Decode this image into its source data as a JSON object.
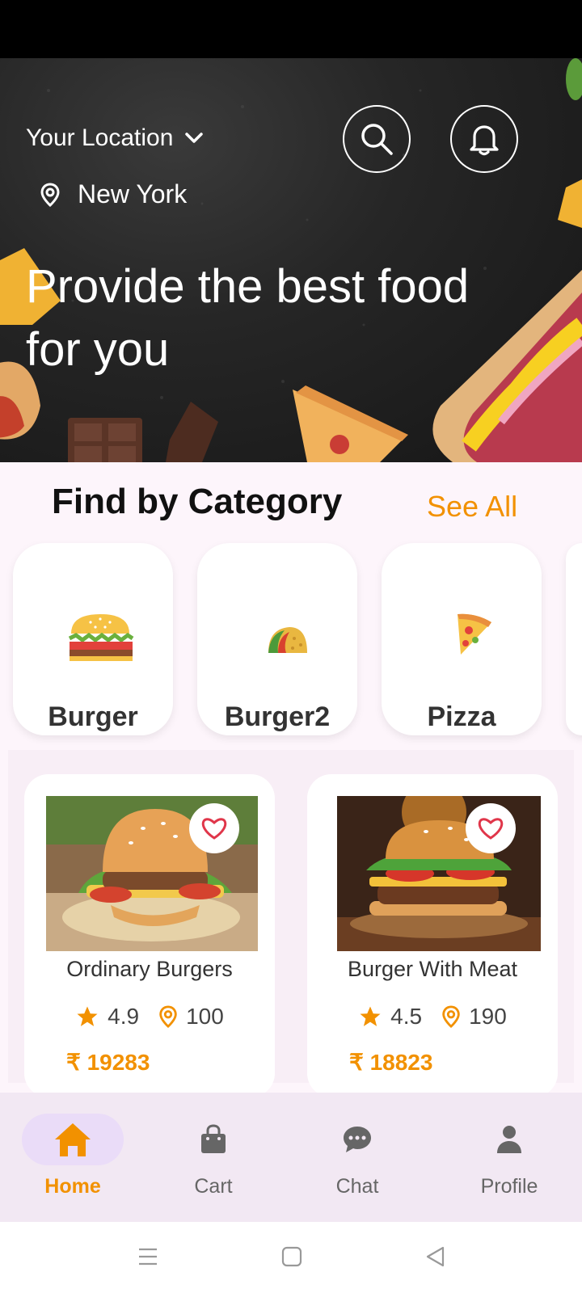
{
  "header": {
    "location_label": "Your Location",
    "city": "New York",
    "title": "Provide the best food for you"
  },
  "categories": {
    "title": "Find by Category",
    "see_all": "See All",
    "items": [
      {
        "label": "Burger",
        "icon": "burger-icon"
      },
      {
        "label": "Burger2",
        "icon": "taco-icon"
      },
      {
        "label": "Pizza",
        "icon": "pizza-icon"
      }
    ]
  },
  "products": [
    {
      "name": "Ordinary Burgers",
      "rating": "4.9",
      "distance": "100",
      "price": "₹ 19283"
    },
    {
      "name": "Burger With Meat",
      "rating": "4.5",
      "distance": "190",
      "price": "₹ 18823"
    }
  ],
  "nav": {
    "items": [
      {
        "label": "Home",
        "icon": "home-icon",
        "active": true
      },
      {
        "label": "Cart",
        "icon": "bag-icon",
        "active": false
      },
      {
        "label": "Chat",
        "icon": "chat-icon",
        "active": false
      },
      {
        "label": "Profile",
        "icon": "person-icon",
        "active": false
      }
    ]
  },
  "colors": {
    "accent": "#f29100",
    "nav_active_bg": "#eadcf8",
    "page_bg": "#fdf5fb"
  }
}
